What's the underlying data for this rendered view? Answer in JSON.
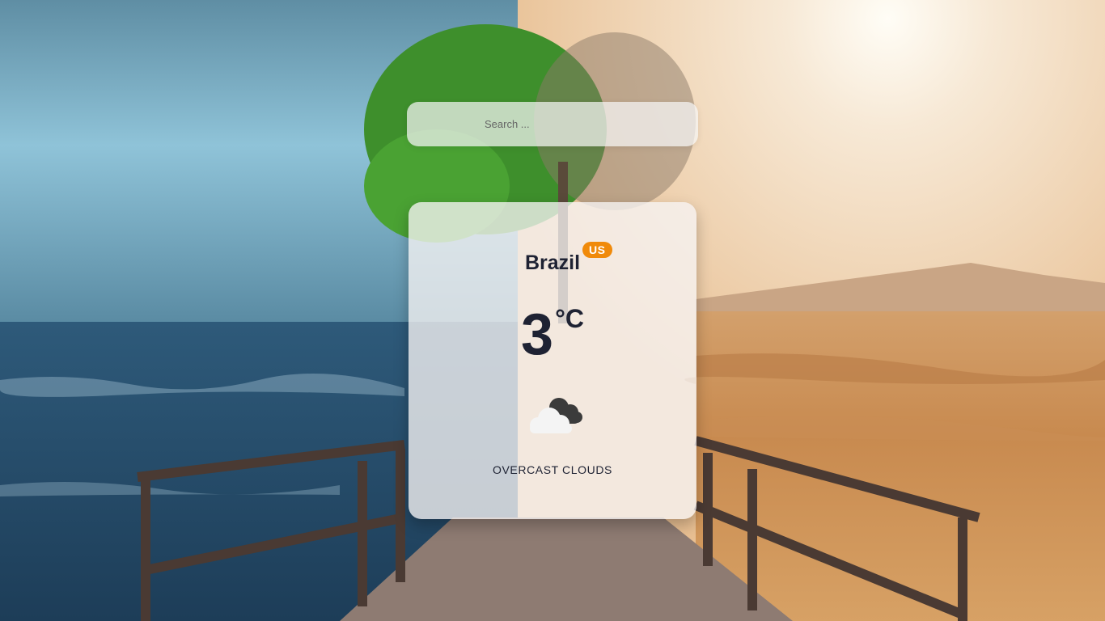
{
  "search": {
    "placeholder": "Search ...",
    "value": ""
  },
  "weather": {
    "city": "Brazil",
    "country_code": "US",
    "temperature": "3",
    "unit": "°C",
    "icon": "overcast-clouds-icon",
    "description": "OVERCAST CLOUDS"
  },
  "colors": {
    "badge": "#f08a0a",
    "text": "#1e2233"
  }
}
